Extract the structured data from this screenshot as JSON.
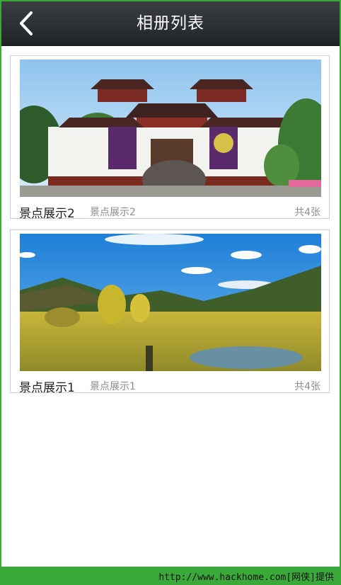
{
  "header": {
    "title": "相册列表",
    "back_icon": "chevron-left-icon"
  },
  "albums": [
    {
      "name": "景点展示2",
      "subtitle": "景点展示2",
      "count": "共4张"
    },
    {
      "name": "景点展示1",
      "subtitle": "景点展示1",
      "count": "共4张"
    }
  ],
  "footer": {
    "watermark": "http://www.hackhome.com[网侠]提供"
  },
  "colors": {
    "header_dark": "#202326",
    "page_bg": "#ffffff",
    "status_green": "#3aa93a"
  }
}
